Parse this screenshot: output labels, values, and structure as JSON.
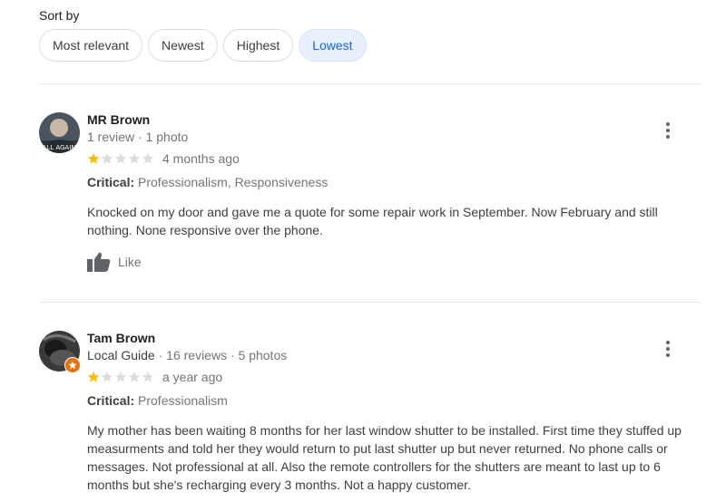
{
  "sort": {
    "label": "Sort by",
    "options": [
      "Most relevant",
      "Newest",
      "Highest",
      "Lowest"
    ],
    "selected": "Lowest"
  },
  "reviews": [
    {
      "name": "MR Brown",
      "meta": "1 review · 1 photo",
      "rating": 1,
      "max_rating": 5,
      "when": "4 months ago",
      "critical_label": "Critical:",
      "critical_value": "Professionalism, Responsiveness",
      "text": "Knocked on my door and gave me a quote for some repair work in September. Now February and still nothing. None responsive over the phone.",
      "like_label": "Like",
      "avatar_caption": "ALL AGAIN"
    },
    {
      "name": "Tam Brown",
      "meta_guide": "Local Guide",
      "meta": " · 16 reviews · 5 photos",
      "rating": 1,
      "max_rating": 5,
      "when": "a year ago",
      "critical_label": "Critical:",
      "critical_value": "Professionalism",
      "text": "My mother has been waiting 8 months for her last window shutter to be installed. First time they stuffed up measurments and told her they would return to put last shutter up but never returned. No phone calls or messages. Not professional at all. Also the remote controllers for the shutters are meant to last up to 6 months but she's recharging every 3 months. Not a happy customer."
    }
  ],
  "colors": {
    "star_filled": "#fbbc04",
    "star_empty": "#dadce0",
    "active_chip_bg": "#e8f0fe",
    "active_chip_text": "#1967d2",
    "local_guide_badge": "#e8710a"
  }
}
